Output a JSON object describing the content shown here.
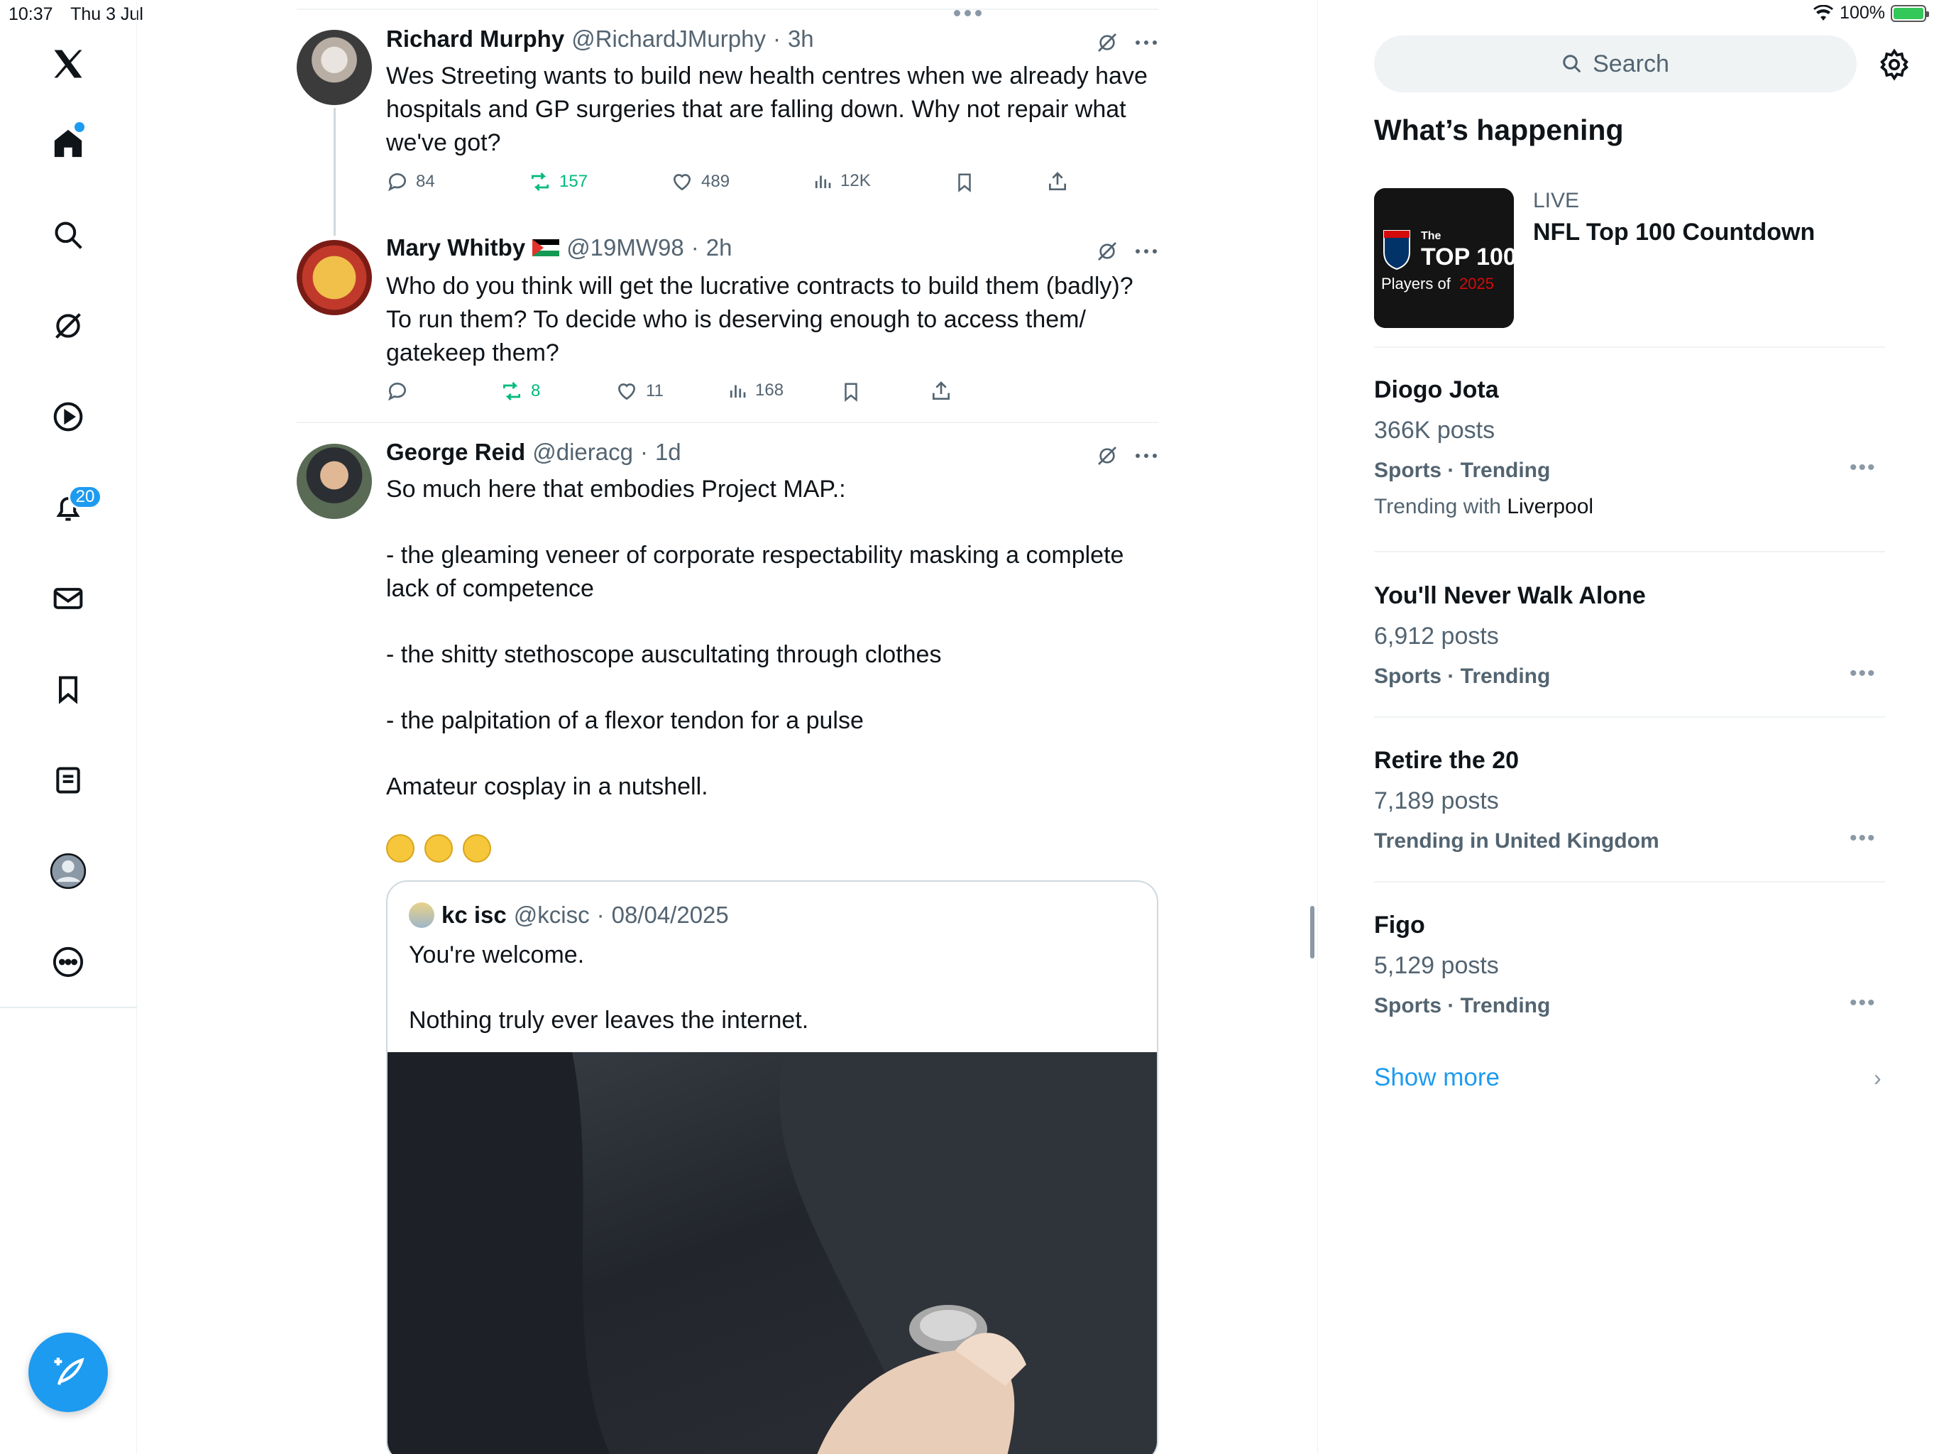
{
  "status": {
    "time": "10:37",
    "date": "Thu 3 Jul",
    "battery": "100%"
  },
  "nav": {
    "notifications_badge": "20"
  },
  "posts": [
    {
      "name": "Richard Murphy",
      "handle": "@RichardJMurphy",
      "time": "3h",
      "text": "Wes Streeting wants to build new health centres when we already have hospitals and GP surgeries that are falling down. Why not repair what we've got?",
      "replies": "84",
      "reposts": "157",
      "likes": "489",
      "views": "12K"
    },
    {
      "name": "Mary Whitby",
      "handle": "@19MW98",
      "time": "2h",
      "text": "Who do you think will get the lucrative contracts to build them (badly)? To run them? To decide who is deserving enough to access them/ gatekeep them?",
      "replies": "",
      "reposts": "8",
      "likes": "11",
      "views": "168"
    },
    {
      "name": "George Reid",
      "handle": "@dieracg",
      "time": "1d",
      "text": "So much here that embodies Project MAP.:\n\n- the gleaming veneer of corporate respectability masking a complete lack of competence\n\n- the shitty stethoscope auscultating through clothes\n\n- the palpitation of a flexor tendon for a pulse\n\nAmateur cosplay in a nutshell.",
      "quote": {
        "name": "kc isc",
        "handle": "@kcisc",
        "date": "08/04/2025",
        "text": "You're welcome.\n\nNothing truly ever leaves the internet."
      }
    }
  ],
  "sidebar": {
    "search_placeholder": "Search",
    "title": "What’s happening",
    "live": {
      "label": "LIVE",
      "title": "NFL Top 100 Countdown",
      "thumb_line1": "The",
      "thumb_line2": "TOP 100",
      "thumb_line3": "Players of",
      "thumb_year": "2025"
    },
    "trends": [
      {
        "title": "Diogo Jota",
        "count": "366K posts",
        "category": "Sports · Trending",
        "with_label": "Trending with",
        "with": "Liverpool"
      },
      {
        "title": "You'll Never Walk Alone",
        "count": "6,912 posts",
        "category": "Sports · Trending"
      },
      {
        "title": "Retire the 20",
        "count": "7,189 posts",
        "category": "Trending in United Kingdom"
      },
      {
        "title": "Figo",
        "count": "5,129 posts",
        "category": "Sports · Trending"
      }
    ],
    "show_more": "Show more"
  },
  "colors": {
    "accent": "#1d9bf0",
    "repost": "#00ba7c",
    "muted": "#536471"
  }
}
